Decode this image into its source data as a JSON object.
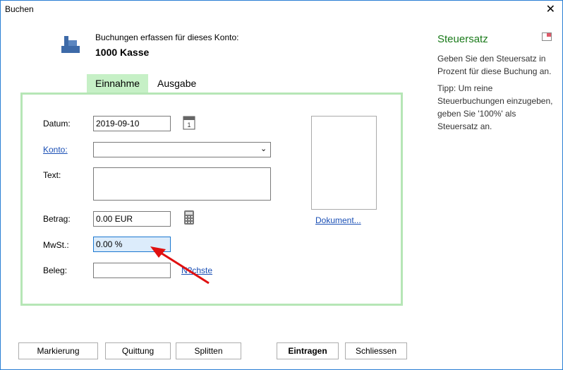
{
  "window": {
    "title": "Buchen",
    "close": "✕"
  },
  "header": {
    "subtitle": "Buchungen erfassen für dieses Konto:",
    "account": "1000 Kasse"
  },
  "tabs": [
    {
      "label": "Einnahme",
      "active": true
    },
    {
      "label": "Ausgabe",
      "active": false
    }
  ],
  "form": {
    "datum_label": "Datum:",
    "datum_value": "2019-09-10",
    "konto_label": "Konto:",
    "konto_value": "",
    "text_label": "Text:",
    "text_value": "",
    "betrag_label": "Betrag:",
    "betrag_value": "0.00 EUR",
    "mwst_label": "MwSt.:",
    "mwst_value": "0.00 %",
    "beleg_label": "Beleg:",
    "beleg_value": "",
    "next_link": "N?chste",
    "dokument_link": "Dokument..."
  },
  "help": {
    "title": "Steuersatz",
    "text1": "Geben Sie den Steuersatz in Prozent für diese Buchung an.",
    "text2": "Tipp:  Um reine Steuerbuchungen einzugeben, geben Sie '100%' als Steuersatz an."
  },
  "buttons": {
    "markierung": "Markierung",
    "quittung": "Quittung",
    "splitten": "Splitten",
    "eintragen": "Eintragen",
    "schliessen": "Schliessen"
  }
}
